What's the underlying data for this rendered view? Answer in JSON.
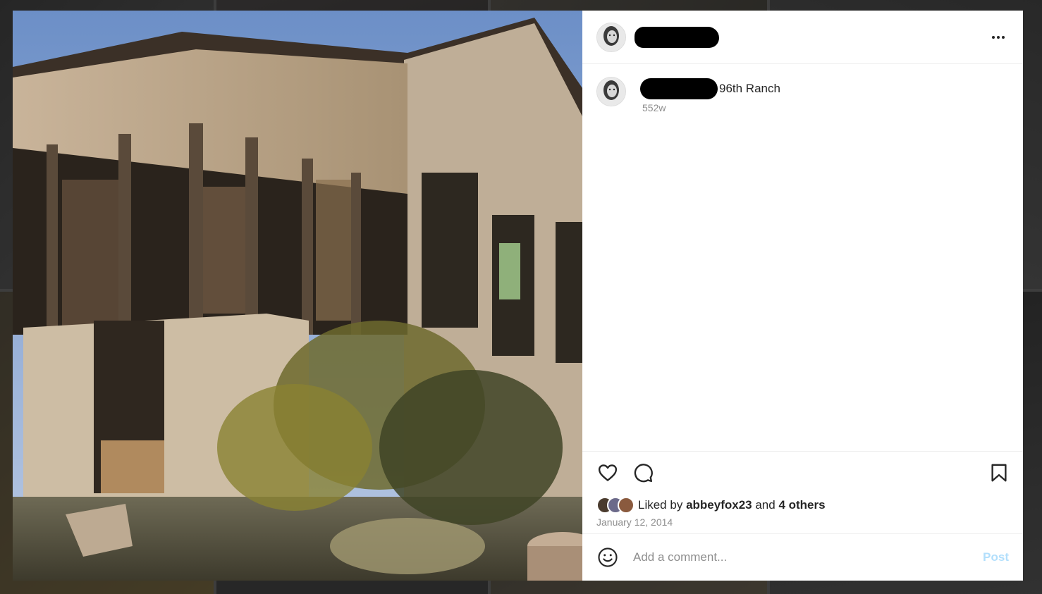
{
  "post": {
    "header_avatar": "avatar-icon",
    "more_icon": "more-options-icon",
    "caption": {
      "text": "96th Ranch",
      "time": "552w"
    },
    "likes": {
      "prefix": "Liked by",
      "user": "abbeyfox23",
      "middle": "and",
      "others": "4 others"
    },
    "date": "January 12, 2014",
    "comment": {
      "placeholder": "Add a comment...",
      "post_label": "Post"
    }
  },
  "icons": {
    "like": "heart-icon",
    "comment": "comment-bubble-icon",
    "save": "bookmark-icon",
    "emoji": "smiley-icon"
  },
  "colors": {
    "accent_disabled": "#b2dffc",
    "text_primary": "#262626",
    "text_secondary": "#8e8e8e"
  }
}
